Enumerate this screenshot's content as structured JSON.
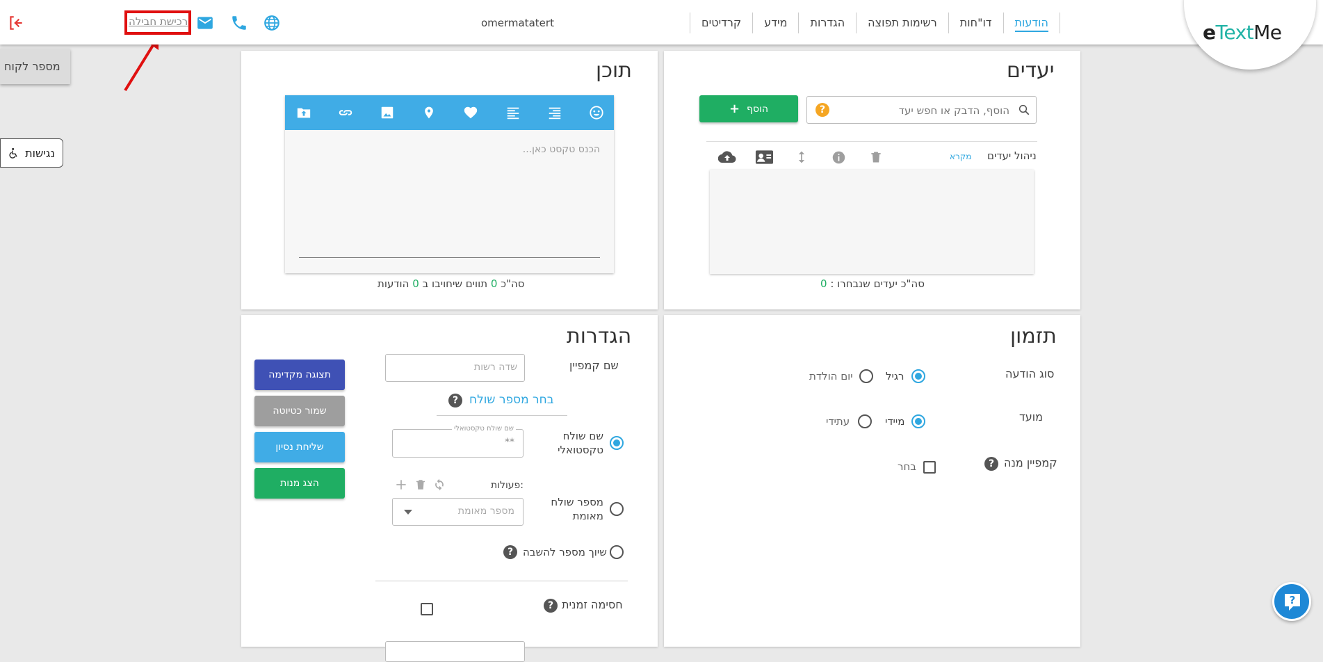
{
  "header": {
    "logo": {
      "e": "e",
      "text": "Text",
      "me": "Me"
    },
    "nav": [
      "הודעות",
      "דו\"חות",
      "רשימות תפוצה",
      "הגדרות",
      "מידע",
      "קרדיטים"
    ],
    "username": "omermatatert",
    "logout_link": "רכישת חבילה",
    "icons": [
      "globe-icon",
      "phone-icon",
      "mail-icon",
      "logout-icon"
    ]
  },
  "sidebar": {
    "client_number_tab": "מספר לקוח",
    "accessibility": "נגישות"
  },
  "recipients": {
    "title": "יעדים",
    "search_placeholder": "הוסף, הדבק או חפש יעד",
    "add_button": "הוסף",
    "manage_label": "ניהול יעדים",
    "legend_link": "מקרא",
    "total_label": "סה\"כ יעדים שנבחרו :",
    "total_count": "0"
  },
  "content": {
    "title": "תוכן",
    "editor_placeholder": "הכנס טקסט כאן...",
    "summary_prefix": "סה\"כ",
    "chars_count": "0",
    "summary_middle": "תווים שיחויבו ב",
    "messages_count": "0",
    "summary_suffix": "הודעות"
  },
  "scheduling": {
    "title": "תזמון",
    "message_type_label": "סוג הודעה",
    "type_regular": "רגיל",
    "type_birthday": "יום הולדת",
    "timing_label": "מועד",
    "timing_now": "מיידי",
    "timing_future": "עתידי",
    "subscription_label": "קמפיין מנה",
    "choose": "בחר"
  },
  "settings": {
    "title": "הגדרות",
    "campaign_name_label": "שם קמפיין",
    "campaign_name_placeholder": "שדה רשות",
    "choose_sender": "בחר מספר שולח",
    "textual_sender_label": "שם שולח טקסטואלי",
    "textual_sender_field_label": "שם שולח טקסטואלי",
    "textual_sender_value": "**",
    "verified_sender_label": "מספר שולח מאומת",
    "actions_label": "פעולות:",
    "verified_number_placeholder": "מספר מאומת",
    "reply_number_label": "שיוך מספר להשבה",
    "temporary_block_label": "חסימה זמנית"
  },
  "actions": {
    "preview": "תצוגה מקדימה",
    "save_draft": "שמור כטיוטה",
    "send_test": "שליחת נסיון",
    "show_subscription": "הצג מנות"
  },
  "colors": {
    "accent": "#2fa7e0",
    "green": "#1fae63",
    "indigo": "#3f51b5",
    "grey_button": "#9e9e9e",
    "highlight_red": "#e01010"
  }
}
